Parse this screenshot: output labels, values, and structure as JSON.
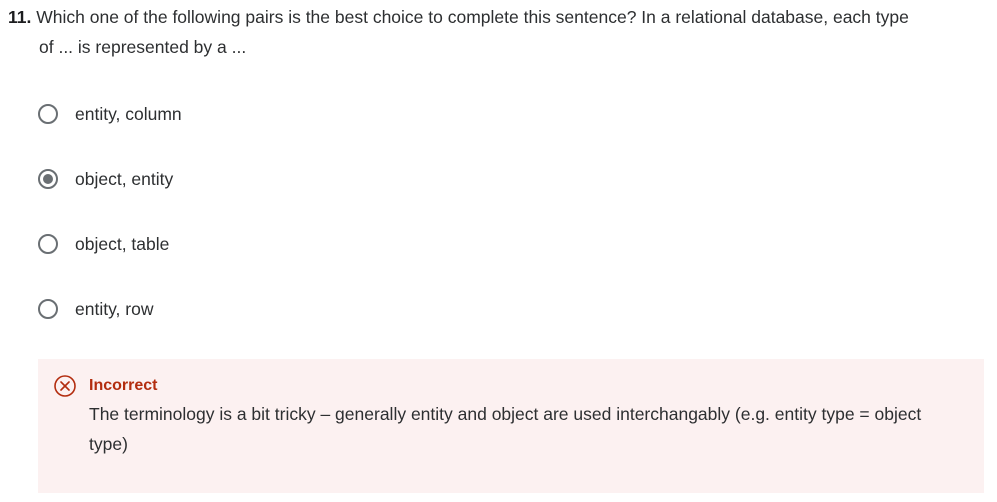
{
  "question": {
    "number": "11.",
    "text_line1": "Which one of the following pairs is the best choice to complete this sentence? In a relational database, each type",
    "text_line2": "of ... is represented by a ..."
  },
  "options": [
    {
      "label": "entity, column",
      "selected": false
    },
    {
      "label": "object, entity",
      "selected": true
    },
    {
      "label": "object, table",
      "selected": false
    },
    {
      "label": "entity, row",
      "selected": false
    }
  ],
  "feedback": {
    "status": "Incorrect",
    "icon": "x-circle-icon",
    "explanation": "The terminology is a bit tricky – generally entity and object are used interchangably (e.g. entity type = object type)",
    "colors": {
      "background": "#fcf1f1",
      "status": "#b32d0f"
    }
  }
}
